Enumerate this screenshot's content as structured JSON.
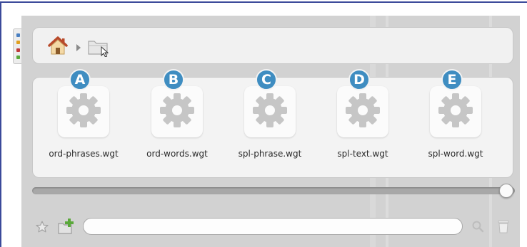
{
  "breadcrumb": {
    "items": [
      {
        "icon": "home-icon"
      },
      {
        "icon": "breadcrumb-separator-icon"
      },
      {
        "icon": "folder-icon"
      }
    ]
  },
  "files": [
    {
      "badge": "A",
      "name": "ord-phrases.wgt",
      "icon": "gear-icon"
    },
    {
      "badge": "B",
      "name": "ord-words.wgt",
      "icon": "gear-icon"
    },
    {
      "badge": "C",
      "name": "spl-phrase.wgt",
      "icon": "gear-icon"
    },
    {
      "badge": "D",
      "name": "spl-text.wgt",
      "icon": "gear-icon"
    },
    {
      "badge": "E",
      "name": "spl-word.wgt",
      "icon": "gear-icon"
    }
  ],
  "zoom_slider": {
    "value_fraction": 1.0
  },
  "toolbar": {
    "favorite_icon": "star-icon",
    "new_folder_icon": "new-folder-icon",
    "search_value": "",
    "search_icon": "search-icon",
    "trash_icon": "trash-icon"
  },
  "colors": {
    "badge": "#3f8dc1",
    "panel_bg": "#d2d2d2",
    "home_roof": "#b84a2a",
    "add_green": "#5aa83a"
  }
}
